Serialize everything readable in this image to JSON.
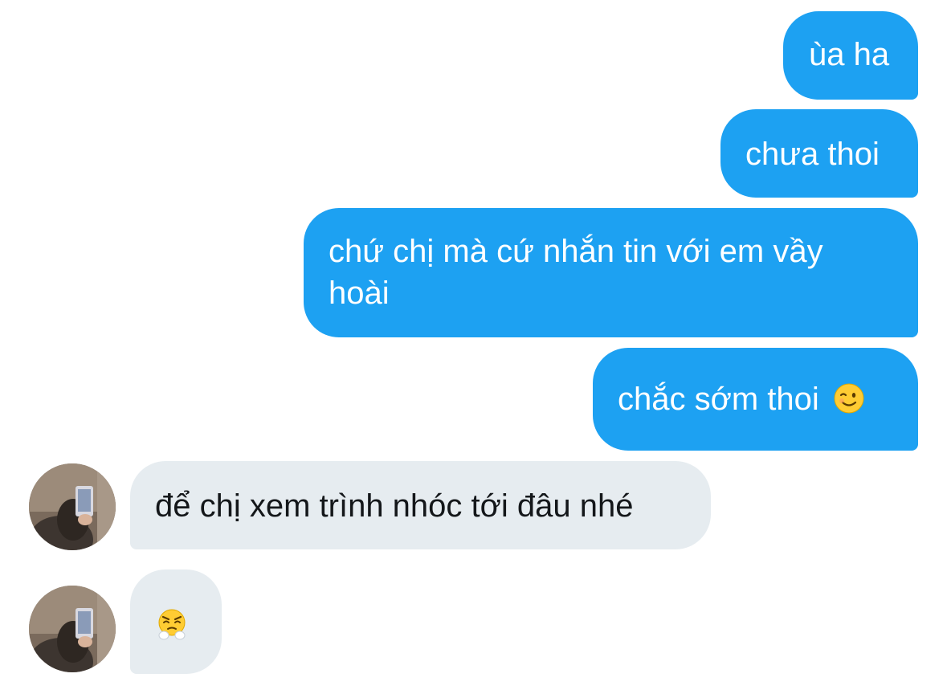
{
  "messages": [
    {
      "direction": "outgoing",
      "text": "ùa ha"
    },
    {
      "direction": "outgoing",
      "text": "chưa thoi"
    },
    {
      "direction": "outgoing",
      "text": "chứ chị mà cứ nhắn tin với em vầy hoài"
    },
    {
      "direction": "outgoing",
      "text": "chắc sớm thoi",
      "emoji": "winking-face-emoji"
    },
    {
      "direction": "incoming",
      "text": "để chị xem trình nhóc tới đâu nhé"
    },
    {
      "direction": "incoming",
      "emoji": "face-with-steam-from-nose-emoji"
    }
  ],
  "colors": {
    "outgoing_bubble": "#1da1f2",
    "incoming_bubble": "#e6ecf0",
    "outgoing_text": "#ffffff",
    "incoming_text": "#14171a"
  },
  "avatar": {
    "icon": "contact-avatar-photo"
  }
}
